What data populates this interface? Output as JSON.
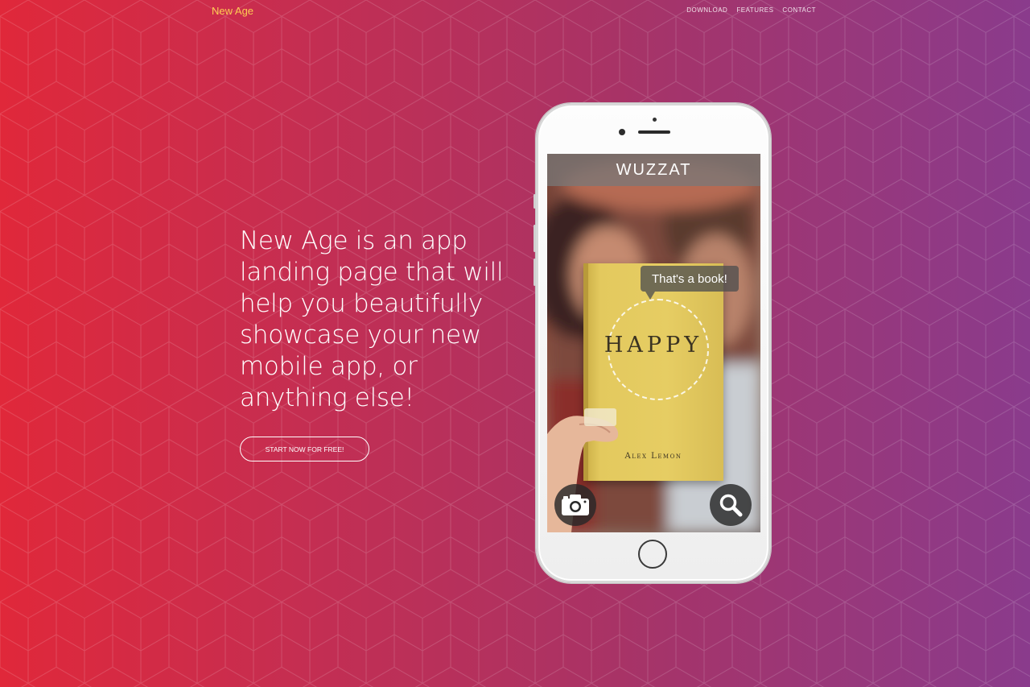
{
  "nav": {
    "brand": "New Age",
    "links": [
      "DOWNLOAD",
      "FEATURES",
      "CONTACT"
    ]
  },
  "hero": {
    "heading": "New Age is an app landing page that will help you beautifully showcase your new mobile app, or anything else!",
    "cta_label": "START NOW FOR FREE!"
  },
  "phone_screen": {
    "app_title": "WUZZAT",
    "bubble_text": "That's a book!",
    "book_title": "HAPPY",
    "book_author": "Alex Lemon",
    "left_button_icon": "camera-icon",
    "right_button_icon": "search-icon"
  },
  "colors": {
    "brand": "#fdcc52",
    "gradient_start": "#e0283a",
    "gradient_end": "#8a3b8c"
  }
}
